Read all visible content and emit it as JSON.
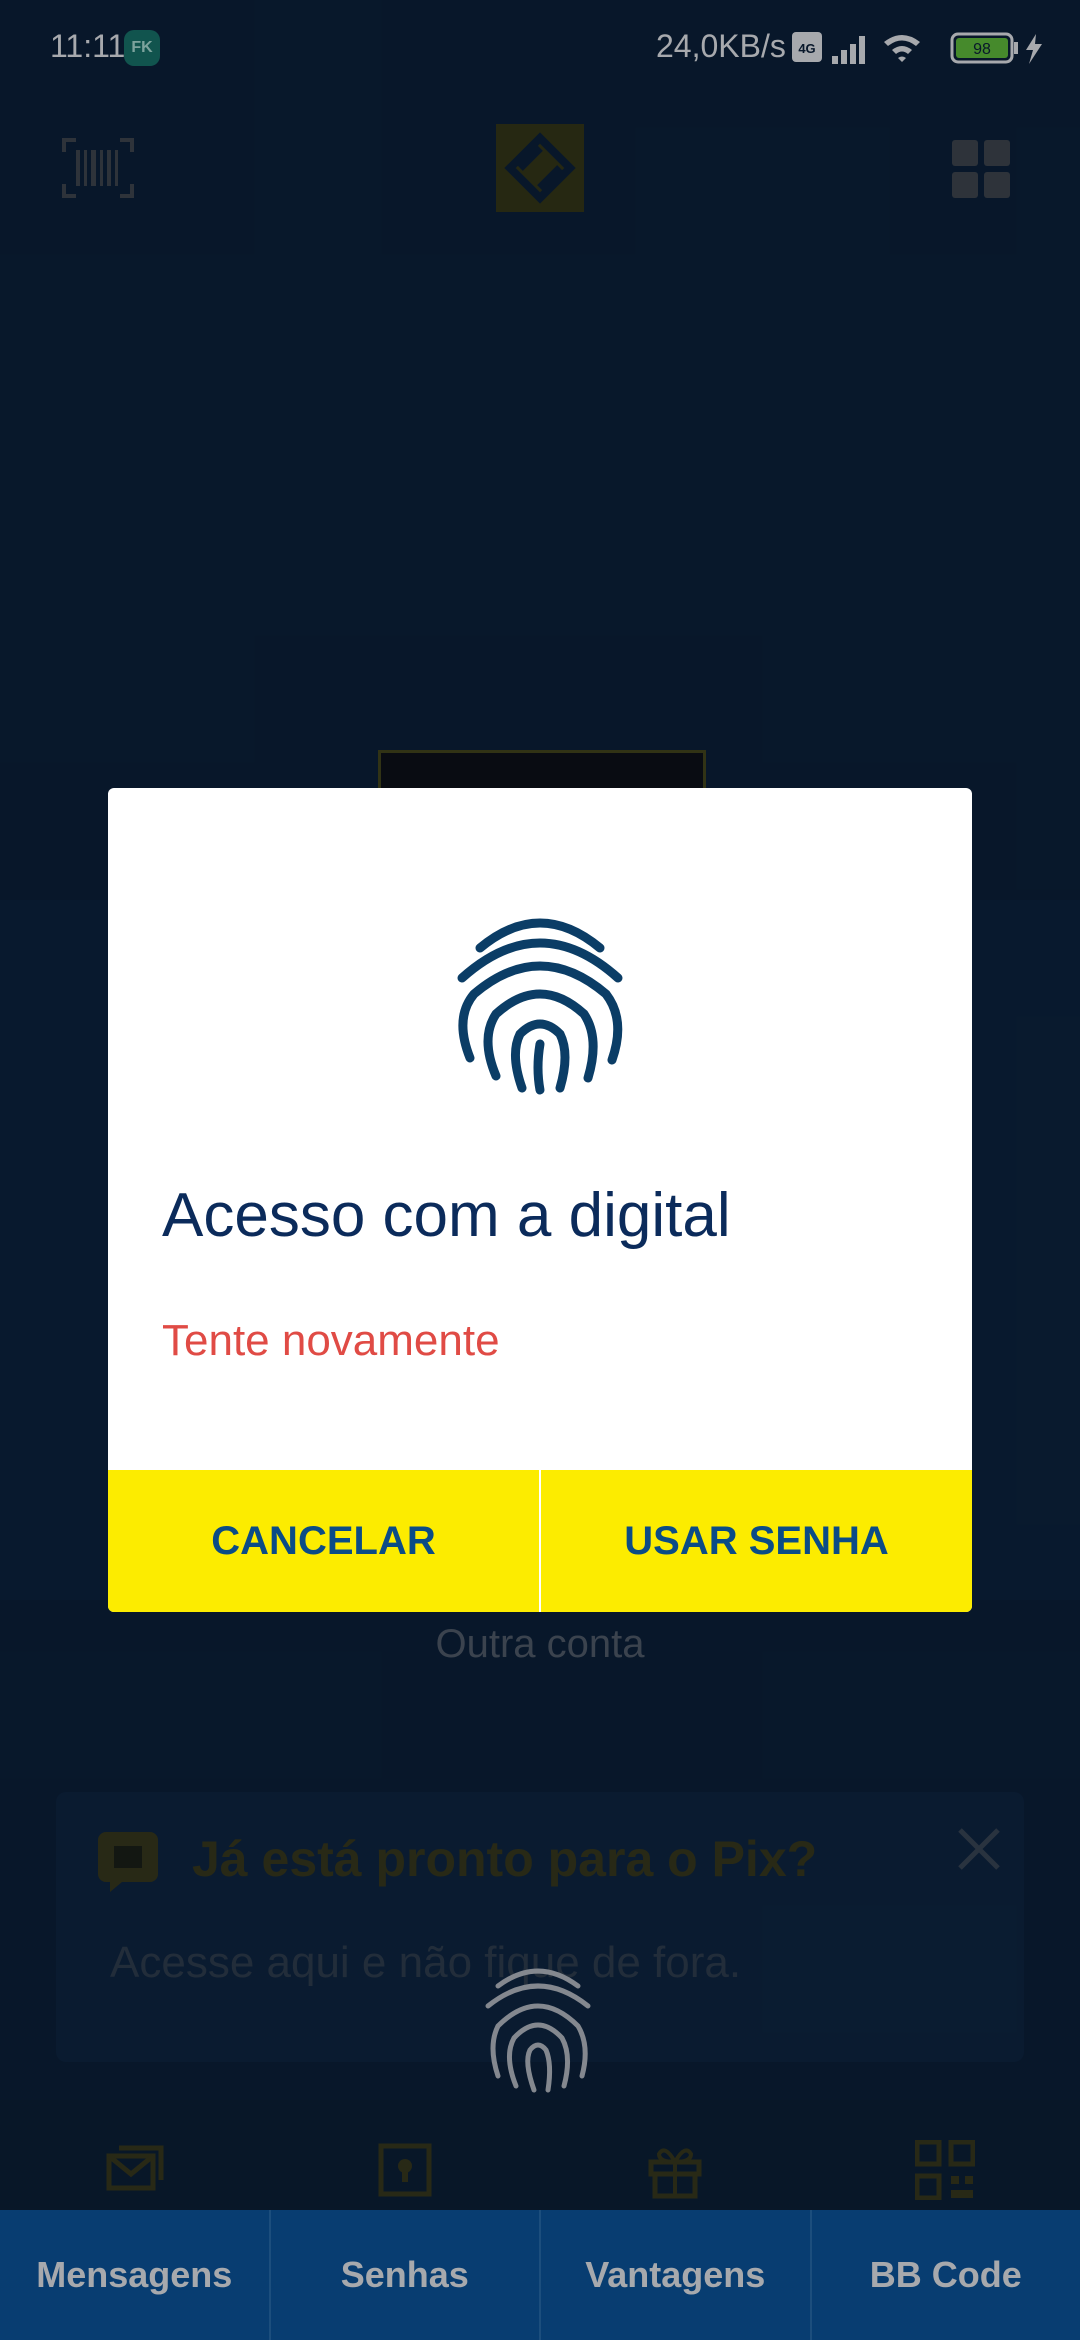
{
  "status_bar": {
    "time": "11:11",
    "app_badge": "FK",
    "network_speed": "24,0KB/s",
    "battery_level": "98"
  },
  "background": {
    "other_account_label": "Outra conta",
    "pix_banner": {
      "title": "Já está pronto para o Pix?",
      "subtitle": "Acesse aqui e não fique de fora."
    }
  },
  "dialog": {
    "title": "Acesso com a digital",
    "error": "Tente novamente",
    "cancel_label": "CANCELAR",
    "password_label": "USAR SENHA"
  },
  "bottom_nav": {
    "items": [
      {
        "label": "Mensagens"
      },
      {
        "label": "Senhas"
      },
      {
        "label": "Vantagens"
      },
      {
        "label": "BB Code"
      }
    ]
  },
  "colors": {
    "dialog_title": "#0b2b5b",
    "error": "#e04b45",
    "button_bg": "#fcec00",
    "nav_bg": "#0b5aa4"
  },
  "icons": [
    "barcode-icon",
    "bb-logo",
    "grid-icon",
    "fingerprint-icon",
    "close-icon",
    "message-icon",
    "lock-icon",
    "gift-icon",
    "qr-code-icon"
  ]
}
